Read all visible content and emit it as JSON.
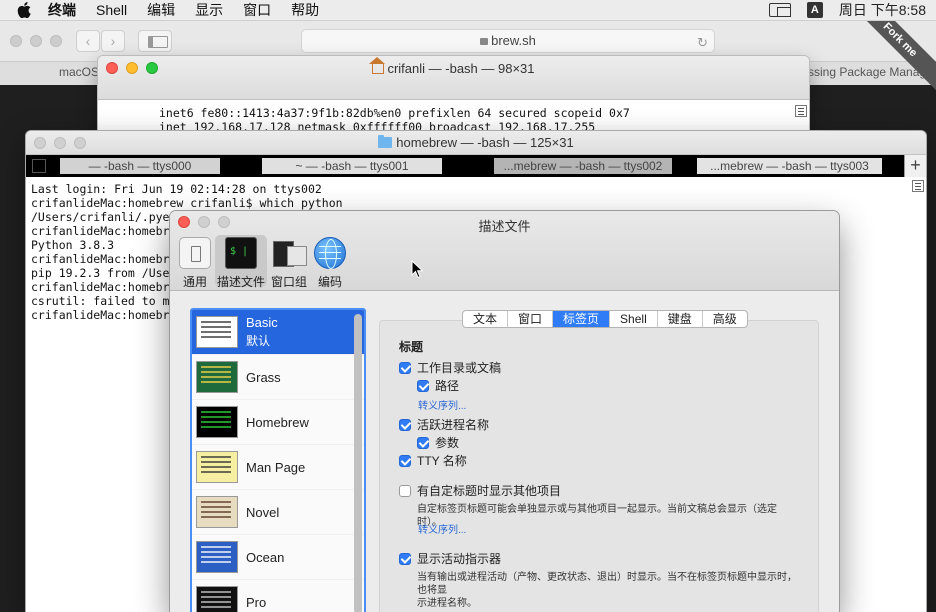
{
  "menubar": {
    "items": [
      "终端",
      "Shell",
      "编辑",
      "显示",
      "窗口",
      "帮助"
    ],
    "input_method": "A",
    "clock": "周日 下午8:58"
  },
  "safari": {
    "url": "brew.sh",
    "tab_left": "macOS",
    "tab_right": "ssing Package Manager f",
    "ribbon": "Fork me"
  },
  "terminal1": {
    "title": "crifanli — -bash — 98×31",
    "lines": [
      "inet6 fe80::1413:4a37:9f1b:82db%en0 prefixlen 64 secured scopeid 0x7",
      "inet 192.168.17.128 netmask 0xffffff00 broadcast 192.168.17.255"
    ]
  },
  "terminal2": {
    "title": "homebrew — -bash — 125×31",
    "tabs": [
      {
        "label": "— -bash — ttys000"
      },
      {
        "label": "~ — -bash — ttys001"
      },
      {
        "label": "...mebrew — -bash — ttys002"
      },
      {
        "label": "...mebrew — -bash — ttys003"
      }
    ],
    "lines": [
      "Last login: Fri Jun 19 02:14:28 on ttys002",
      "crifanlideMac:homebrew crifanli$ which python",
      "/Users/crifanli/.pye",
      "crifanlideMac:homebre",
      "Python 3.8.3",
      "crifanlideMac:homebre",
      "pip 19.2.3 from /Use",
      "crifanlideMac:homebre",
      "csrutil: failed to m",
      "crifanlideMac:homebre"
    ]
  },
  "prefs": {
    "title": "描述文件",
    "toolbar": [
      {
        "label": "通用",
        "icon": "general-icon"
      },
      {
        "label": "描述文件",
        "icon": "profiles-icon"
      },
      {
        "label": "窗口组",
        "icon": "window-groups-icon"
      },
      {
        "label": "编码",
        "icon": "encoding-icon"
      }
    ],
    "profiles": [
      {
        "name": "Basic",
        "sub": "默认",
        "thumb_bg": "#ffffff",
        "thumb_fg": "#333333"
      },
      {
        "name": "Grass",
        "thumb_bg": "#1e6a3c",
        "thumb_fg": "#f7d84b"
      },
      {
        "name": "Homebrew",
        "thumb_bg": "#000000",
        "thumb_fg": "#2fd43a"
      },
      {
        "name": "Man Page",
        "thumb_bg": "#f6efa2",
        "thumb_fg": "#333333"
      },
      {
        "name": "Novel",
        "thumb_bg": "#e8dcc0",
        "thumb_fg": "#5b3b2a"
      },
      {
        "name": "Ocean",
        "thumb_bg": "#2b5fc4",
        "thumb_fg": "#ffffff"
      },
      {
        "name": "Pro",
        "thumb_bg": "#111111",
        "thumb_fg": "#cccccc"
      }
    ],
    "segments": [
      "文本",
      "窗口",
      "标签页",
      "Shell",
      "键盘",
      "高级"
    ],
    "active_segment": "标签页",
    "section_title": "标题",
    "options": {
      "workdir": "工作目录或文稿",
      "path": "路径",
      "escape1": "转义序列...",
      "active_process": "活跃进程名称",
      "args": "参数",
      "tty": "TTY 名称",
      "custom_title": "有自定标题时显示其他项目",
      "custom_note": "自定标签页标题可能会单独显示或与其他项目一起显示。当前文稿总会显示（选定时）。",
      "escape2": "转义序列...",
      "activity": "显示活动指示器",
      "activity_note_1": "当有输出或进程活动（产物、更改状态、退出）时显示。当不在标签页标题中显示时，也将显",
      "activity_note_2": "示进程名称。"
    }
  }
}
